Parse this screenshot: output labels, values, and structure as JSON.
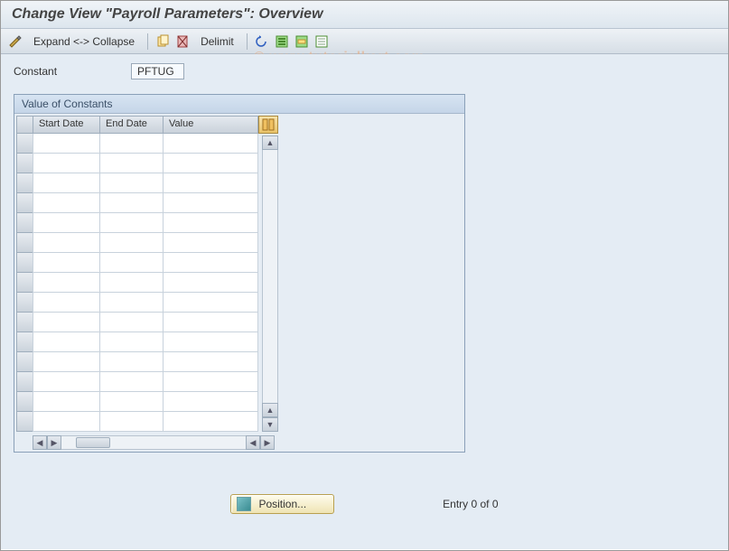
{
  "title": "Change View \"Payroll Parameters\": Overview",
  "toolbar": {
    "expand_collapse": "Expand <-> Collapse",
    "delimit": "Delimit"
  },
  "field": {
    "label": "Constant",
    "value": "PFTUG"
  },
  "panel": {
    "title": "Value of Constants",
    "columns": {
      "start_date": "Start Date",
      "end_date": "End Date",
      "value": "Value"
    },
    "rows": [
      {
        "start_date": "",
        "end_date": "",
        "value": ""
      },
      {
        "start_date": "",
        "end_date": "",
        "value": ""
      },
      {
        "start_date": "",
        "end_date": "",
        "value": ""
      },
      {
        "start_date": "",
        "end_date": "",
        "value": ""
      },
      {
        "start_date": "",
        "end_date": "",
        "value": ""
      },
      {
        "start_date": "",
        "end_date": "",
        "value": ""
      },
      {
        "start_date": "",
        "end_date": "",
        "value": ""
      },
      {
        "start_date": "",
        "end_date": "",
        "value": ""
      },
      {
        "start_date": "",
        "end_date": "",
        "value": ""
      },
      {
        "start_date": "",
        "end_date": "",
        "value": ""
      },
      {
        "start_date": "",
        "end_date": "",
        "value": ""
      },
      {
        "start_date": "",
        "end_date": "",
        "value": ""
      },
      {
        "start_date": "",
        "end_date": "",
        "value": ""
      },
      {
        "start_date": "",
        "end_date": "",
        "value": ""
      },
      {
        "start_date": "",
        "end_date": "",
        "value": ""
      }
    ]
  },
  "footer": {
    "position_label": "Position...",
    "entry_status": "Entry 0 of 0"
  },
  "watermark": "© www.tutorialkart.com",
  "icons": {
    "pencil": "pencil-icon",
    "copy": "copy-icon",
    "delete": "delete-icon",
    "undo": "undo-icon",
    "select_all": "select-all-icon",
    "select_block": "select-block-icon",
    "deselect_all": "deselect-all-icon",
    "config": "configure-column-icon"
  }
}
